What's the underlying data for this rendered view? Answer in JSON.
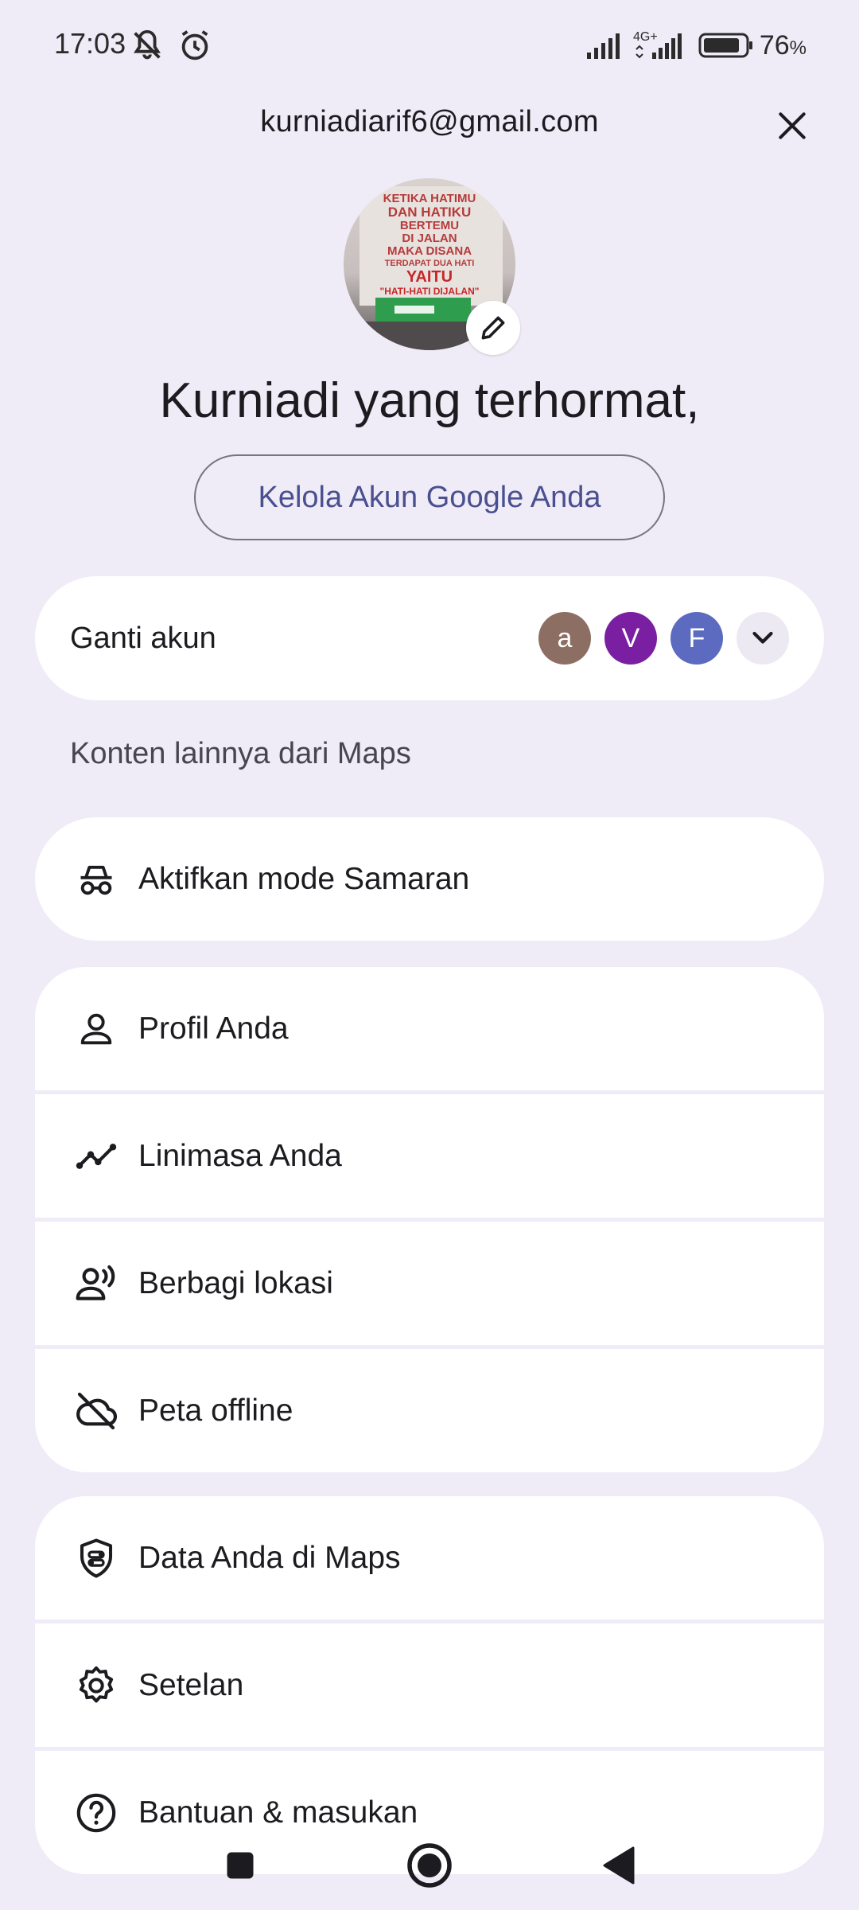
{
  "status_bar": {
    "time": "17:03",
    "network": "4G+",
    "battery_percent": "76",
    "battery_unit": "%"
  },
  "header": {
    "email": "kurniadiarif6@gmail.com",
    "close_icon": "close-icon"
  },
  "profile": {
    "greeting": "Kurniadi yang terhormat,",
    "manage_button": "Kelola Akun Google Anda",
    "photo_text": [
      "KETIKA HATIMU",
      "DAN HATIKU",
      "BERTEMU",
      "DI JALAN",
      "MAKA DISANA",
      "TERDAPAT DUA HATI",
      "YAITU",
      "\"HATI-HATI DIJALAN\""
    ]
  },
  "switch_account": {
    "label": "Ganti akun",
    "accounts": [
      {
        "initial": "a",
        "color": "#8d6e63"
      },
      {
        "initial": "V",
        "color": "#7b1fa2"
      },
      {
        "initial": "F",
        "color": "#5c6bc0"
      }
    ]
  },
  "section_label": "Konten lainnya dari Maps",
  "incognito": {
    "label": "Aktifkan mode Samaran",
    "icon": "incognito-icon"
  },
  "group1": [
    {
      "label": "Profil Anda",
      "icon": "person-icon"
    },
    {
      "label": "Linimasa Anda",
      "icon": "timeline-icon"
    },
    {
      "label": "Berbagi lokasi",
      "icon": "location-sharing-icon"
    },
    {
      "label": "Peta offline",
      "icon": "offline-map-icon"
    }
  ],
  "group2": [
    {
      "label": "Data Anda di Maps",
      "icon": "shield-icon"
    },
    {
      "label": "Setelan",
      "icon": "gear-icon"
    },
    {
      "label": "Bantuan & masukan",
      "icon": "help-icon"
    }
  ],
  "colors": {
    "background": "#efecf7",
    "card": "#ffffff",
    "accent_text": "#4a4f90"
  }
}
